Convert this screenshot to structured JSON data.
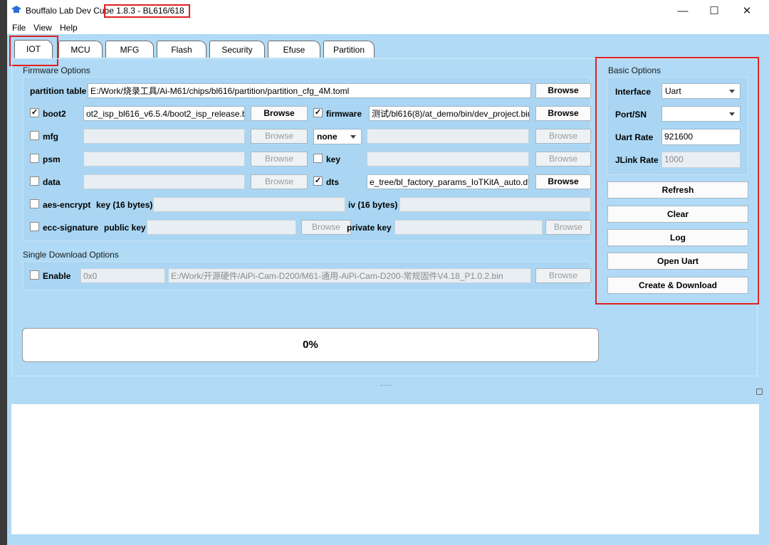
{
  "window": {
    "title_prefix": "Bouffalo Lab Dev Cub",
    "title_suffix": "e 1.8.3 - BL616/618",
    "minimize": "—",
    "maximize": "☐",
    "close": "✕"
  },
  "menu": {
    "file": "File",
    "view": "View",
    "help": "Help"
  },
  "tabs": [
    "IOT",
    "MCU",
    "MFG",
    "Flash",
    "Security",
    "Efuse",
    "Partition"
  ],
  "firmware_options": {
    "title": "Firmware Options",
    "partition_table_label": "partition table",
    "partition_table_value": "E:/Work/烧录工具/Ai-M61/chips/bl616/partition/partition_cfg_4M.toml",
    "browse": "Browse",
    "boot2_label": "boot2",
    "boot2_checked": "✓",
    "boot2_value": "ot2_isp_bl616_v6.5.4/boot2_isp_release.bin",
    "firmware_label": "firmware",
    "firmware_checked": "✓",
    "firmware_value": "测试/bl616(8)/at_demo/bin/dev_project.bin",
    "mfg_label": "mfg",
    "mfg_select": "none",
    "psm_label": "psm",
    "key_label": "key",
    "data_label": "data",
    "dts_label": "dts",
    "dts_checked": "✓",
    "dts_value": "e_tree/bl_factory_params_IoTKitA_auto.dts",
    "aes_label": "aes-encrypt",
    "aes_key_label": "key (16 bytes)",
    "aes_iv_label": "iv (16 bytes)",
    "ecc_label": "ecc-signature",
    "ecc_public_label": "public key",
    "ecc_private_label": "private key"
  },
  "single_download": {
    "title": "Single Download Options",
    "enable_label": "Enable",
    "address": "0x0",
    "path": "E:/Work/开源硬件/AiPi-Cam-D200/M61-通用-AiPi-Cam-D200-常规固件V4.18_P1.0.2.bin",
    "browse": "Browse"
  },
  "progress": {
    "text": "0%",
    "fraction": 0
  },
  "basic_options": {
    "title": "Basic Options",
    "interface_label": "Interface",
    "interface_value": "Uart",
    "port_label": "Port/SN",
    "port_value": "",
    "uart_rate_label": "Uart Rate",
    "uart_rate_value": "921600",
    "jlink_rate_label": "JLink Rate",
    "jlink_rate_value": "1000"
  },
  "actions": {
    "refresh": "Refresh",
    "clear": "Clear",
    "log": "Log",
    "open_uart": "Open Uart",
    "create_download": "Create & Download"
  },
  "colors": {
    "accent_highlight": "#e02020",
    "panel": "#b0daf5"
  }
}
